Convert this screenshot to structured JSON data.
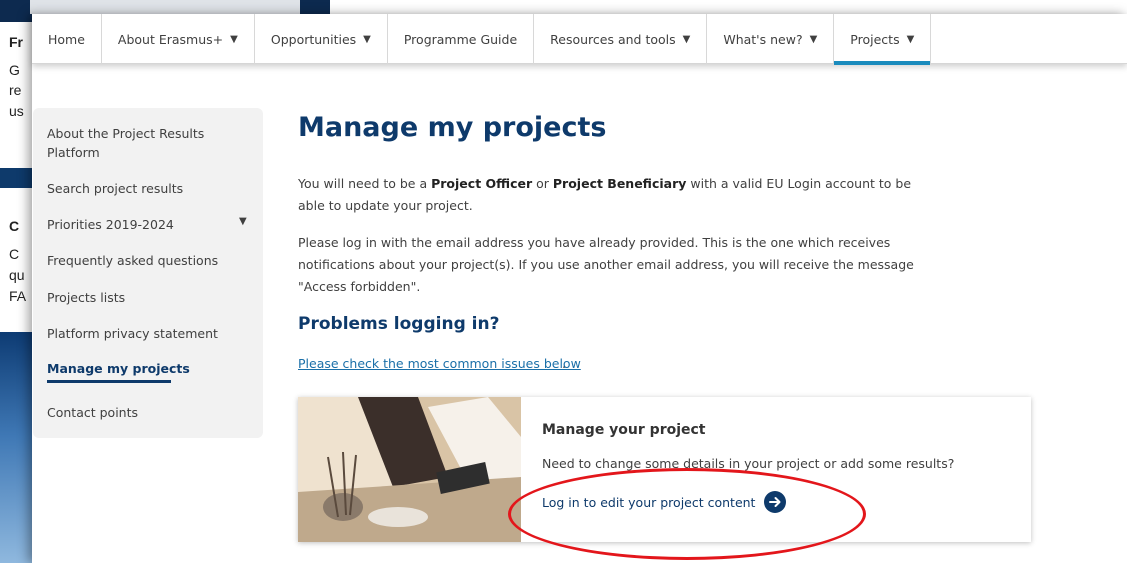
{
  "background_window": {
    "lines": [
      "Fr",
      "G",
      "re",
      "us",
      "C",
      "C",
      "qu",
      "FA"
    ]
  },
  "topnav": {
    "items": [
      {
        "label": "Home",
        "has_caret": false
      },
      {
        "label": "About Erasmus+",
        "has_caret": true
      },
      {
        "label": "Opportunities",
        "has_caret": true
      },
      {
        "label": "Programme Guide",
        "has_caret": false
      },
      {
        "label": "Resources and tools",
        "has_caret": true
      },
      {
        "label": "What's new?",
        "has_caret": true
      },
      {
        "label": "Projects",
        "has_caret": true,
        "active": true
      }
    ],
    "caret_glyph": "▼"
  },
  "sidebar": {
    "items": [
      {
        "label": "About the Project Results Platform"
      },
      {
        "label": "Search project results"
      },
      {
        "label": "Priorities 2019-2024"
      },
      {
        "label": "Frequently asked questions"
      },
      {
        "label": "Projects lists"
      },
      {
        "label": "Platform privacy statement"
      },
      {
        "label": "Manage my projects",
        "active": true
      },
      {
        "label": "Contact points"
      }
    ]
  },
  "main": {
    "title": "Manage my projects",
    "para1": {
      "a": "You will need to be a ",
      "b1": "Project Officer",
      "c": " or ",
      "b2": "Project Beneficiary",
      "d": " with a valid EU Login account to be able to update your project."
    },
    "para2": "Please log in with the email address you have already provided. This is the one which receives notifications about your project(s). If you use another email address, you will receive the message \"Access forbidden\".",
    "subtitle": "Problems logging in?",
    "link": "Please check the most common issues below",
    "link_suffix": "."
  },
  "card": {
    "heading": "Manage your project",
    "text": "Need to change some details in your project or add some results?",
    "link": "Log in to edit your project content"
  },
  "colors": {
    "brand_blue": "#0e3a6b",
    "accent_teal": "#1a8bbd",
    "annotation_red": "#e3161b"
  }
}
